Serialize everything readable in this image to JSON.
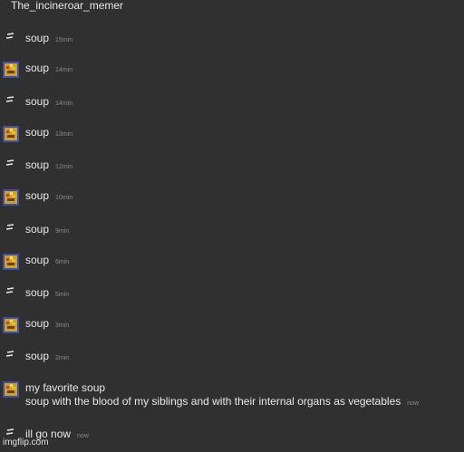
{
  "chat": {
    "title": "The_incineroar_memer",
    "messages": [
      {
        "avatar": "dash",
        "text": "soup",
        "time": "15min"
      },
      {
        "avatar": "pixel",
        "text": "soup",
        "time": "14min"
      },
      {
        "avatar": "dash",
        "text": "soup",
        "time": "14min"
      },
      {
        "avatar": "pixel",
        "text": "soup",
        "time": "13min"
      },
      {
        "avatar": "dash",
        "text": "soup",
        "time": "12min"
      },
      {
        "avatar": "pixel",
        "text": "soup",
        "time": "10min"
      },
      {
        "avatar": "dash",
        "text": "soup",
        "time": "9min"
      },
      {
        "avatar": "pixel",
        "text": "soup",
        "time": "6min"
      },
      {
        "avatar": "dash",
        "text": "soup",
        "time": "5min"
      },
      {
        "avatar": "pixel",
        "text": "soup",
        "time": "3min"
      },
      {
        "avatar": "dash",
        "text": "soup",
        "time": "2min"
      },
      {
        "avatar": "pixel",
        "text": "my favorite soup",
        "text2": "soup with the blood of my siblings and with their internal organs as vegetables",
        "time": "now"
      },
      {
        "avatar": "dash",
        "text": "ill go now",
        "time": "now"
      }
    ]
  },
  "watermark": "imgflip.com",
  "colors": {
    "background": "#303030",
    "text": "#e8e8e8",
    "timestamp": "#8a8a8a"
  }
}
